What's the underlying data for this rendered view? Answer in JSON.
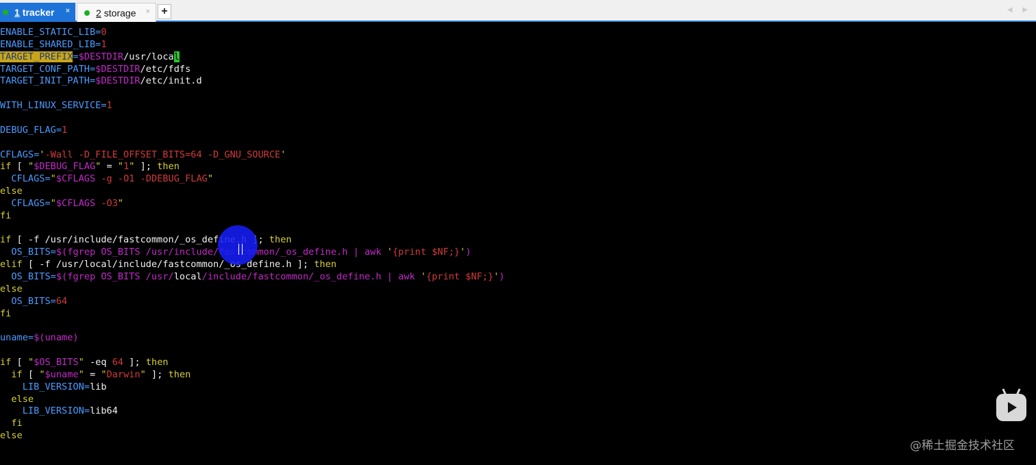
{
  "tabs": [
    {
      "num": "1",
      "label": "tracker",
      "close": "×"
    },
    {
      "num": "2",
      "label": "storage",
      "close": "×"
    }
  ],
  "add_tab_label": "+",
  "scroll_arrows": "◀ ▶",
  "watermark": "@稀土掘金技术社区",
  "code_lines": [
    [
      [
        "b",
        "ENABLE_STATIC_LIB="
      ],
      [
        "r",
        "0"
      ]
    ],
    [
      [
        "b",
        "ENABLE_SHARED_LIB="
      ],
      [
        "r",
        "1"
      ]
    ],
    [
      [
        "hl",
        "TARGET_PREFIX"
      ],
      [
        "b",
        "="
      ],
      [
        "v",
        "$DESTDIR"
      ],
      [
        "w",
        "/usr/loca"
      ],
      [
        "cursor",
        "l"
      ]
    ],
    [
      [
        "b",
        "TARGET_CONF_PATH="
      ],
      [
        "v",
        "$DESTDIR"
      ],
      [
        "w",
        "/etc/fdfs"
      ]
    ],
    [
      [
        "b",
        "TARGET_INIT_PATH="
      ],
      [
        "v",
        "$DESTDIR"
      ],
      [
        "w",
        "/etc/init.d"
      ]
    ],
    [],
    [
      [
        "b",
        "WITH_LINUX_SERVICE="
      ],
      [
        "r",
        "1"
      ]
    ],
    [],
    [
      [
        "b",
        "DEBUG_FLAG="
      ],
      [
        "r",
        "1"
      ]
    ],
    [],
    [
      [
        "b",
        "CFLAGS="
      ],
      [
        "y",
        "'"
      ],
      [
        "r",
        "-Wall -D_FILE_OFFSET_BITS=64 -D_GNU_SOURCE"
      ],
      [
        "y",
        "'"
      ]
    ],
    [
      [
        "y",
        "if"
      ],
      [
        "w",
        " [ "
      ],
      [
        "y",
        "\""
      ],
      [
        "v",
        "$DEBUG_FLAG"
      ],
      [
        "y",
        "\""
      ],
      [
        "w",
        " = "
      ],
      [
        "y",
        "\""
      ],
      [
        "r",
        "1"
      ],
      [
        "y",
        "\""
      ],
      [
        "w",
        " ]; "
      ],
      [
        "y",
        "then"
      ]
    ],
    [
      [
        "b",
        "  CFLAGS="
      ],
      [
        "y",
        "\""
      ],
      [
        "v",
        "$CFLAGS"
      ],
      [
        "r",
        " -g -O1 -DDEBUG_FLAG"
      ],
      [
        "y",
        "\""
      ]
    ],
    [
      [
        "y",
        "else"
      ]
    ],
    [
      [
        "b",
        "  CFLAGS="
      ],
      [
        "y",
        "\""
      ],
      [
        "v",
        "$CFLAGS"
      ],
      [
        "r",
        " -O3"
      ],
      [
        "y",
        "\""
      ]
    ],
    [
      [
        "y",
        "fi"
      ]
    ],
    [],
    [
      [
        "y",
        "if"
      ],
      [
        "w",
        " [ -f /usr/include/fastcommon/_os_define.h ]; "
      ],
      [
        "y",
        "then"
      ]
    ],
    [
      [
        "b",
        "  OS_BITS="
      ],
      [
        "v",
        "$(fgrep OS_BITS /usr/include/fastcommon/_os_define.h | awk "
      ],
      [
        "y",
        "'"
      ],
      [
        "r",
        "{print $NF;}"
      ],
      [
        "y",
        "'"
      ],
      [
        "v",
        ")"
      ]
    ],
    [
      [
        "y",
        "elif"
      ],
      [
        "w",
        " [ -f /usr/local/include/fastcommon/_os_define.h ]; "
      ],
      [
        "y",
        "then"
      ]
    ],
    [
      [
        "b",
        "  OS_BITS="
      ],
      [
        "v",
        "$(fgrep OS_BITS /usr/"
      ],
      [
        "w",
        "local"
      ],
      [
        "v",
        "/include/fastcommon/_os_define.h | awk "
      ],
      [
        "y",
        "'"
      ],
      [
        "r",
        "{print $NF;}"
      ],
      [
        "y",
        "'"
      ],
      [
        "v",
        ")"
      ]
    ],
    [
      [
        "y",
        "else"
      ]
    ],
    [
      [
        "b",
        "  OS_BITS="
      ],
      [
        "r",
        "64"
      ]
    ],
    [
      [
        "y",
        "fi"
      ]
    ],
    [],
    [
      [
        "b",
        "uname="
      ],
      [
        "v",
        "$(uname)"
      ]
    ],
    [],
    [
      [
        "y",
        "if"
      ],
      [
        "w",
        " [ "
      ],
      [
        "y",
        "\""
      ],
      [
        "v",
        "$OS_BITS"
      ],
      [
        "y",
        "\""
      ],
      [
        "w",
        " -eq "
      ],
      [
        "r",
        "64"
      ],
      [
        "w",
        " ]; "
      ],
      [
        "y",
        "then"
      ]
    ],
    [
      [
        "y",
        "  if"
      ],
      [
        "w",
        " [ "
      ],
      [
        "y",
        "\""
      ],
      [
        "v",
        "$uname"
      ],
      [
        "y",
        "\""
      ],
      [
        "w",
        " = "
      ],
      [
        "y",
        "\""
      ],
      [
        "r",
        "Darwin"
      ],
      [
        "y",
        "\""
      ],
      [
        "w",
        " ]; "
      ],
      [
        "y",
        "then"
      ]
    ],
    [
      [
        "b",
        "    LIB_VERSION="
      ],
      [
        "w",
        "lib"
      ]
    ],
    [
      [
        "y",
        "  else"
      ]
    ],
    [
      [
        "b",
        "    LIB_VERSION="
      ],
      [
        "w",
        "lib64"
      ]
    ],
    [
      [
        "y",
        "  fi"
      ]
    ],
    [
      [
        "y",
        "else"
      ]
    ]
  ]
}
